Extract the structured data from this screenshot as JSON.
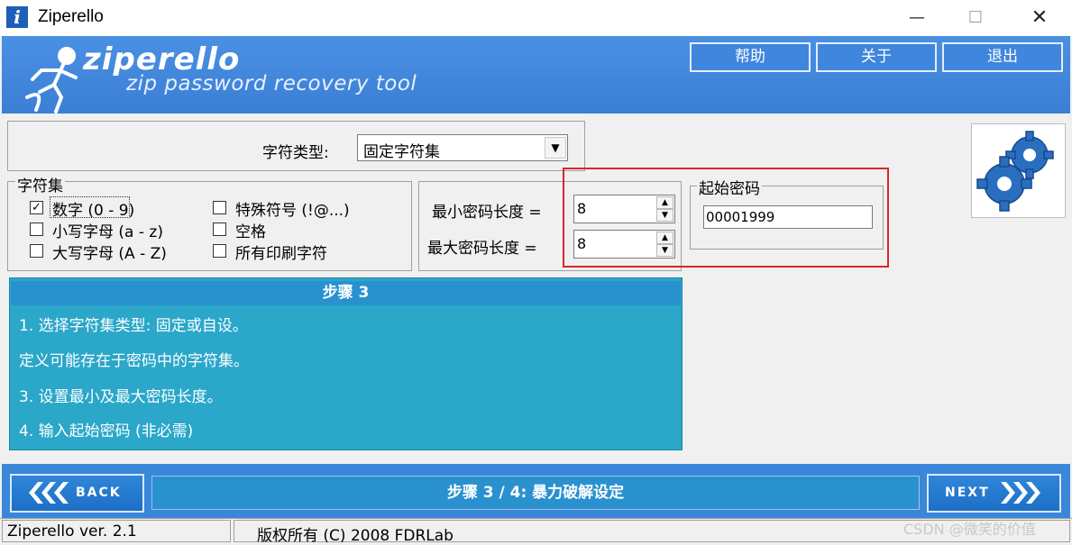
{
  "window": {
    "title": "Ziperello",
    "min_glyph": "—",
    "max_glyph": "☐",
    "close_glyph": "✕"
  },
  "banner": {
    "logo": "ziperello",
    "tagline": "zip password recovery tool",
    "buttons": {
      "help": "帮助",
      "about": "关于",
      "exit": "退出"
    }
  },
  "charset_type": {
    "label": "字符类型:",
    "value": "固定字符集"
  },
  "charset": {
    "legend": "字符集",
    "options": [
      {
        "label": "数字 (0 - 9)",
        "checked": true
      },
      {
        "label": "小写字母 (a - z)",
        "checked": false
      },
      {
        "label": "大写字母 (A - Z)",
        "checked": false
      },
      {
        "label": "特殊符号 (!@...)",
        "checked": false
      },
      {
        "label": "空格",
        "checked": false
      },
      {
        "label": "所有印刷字符",
        "checked": false
      }
    ]
  },
  "length": {
    "min_label": "最小密码长度 =",
    "max_label": "最大密码长度 =",
    "min_value": "8",
    "max_value": "8"
  },
  "start_password": {
    "legend": "起始密码",
    "value": "00001999"
  },
  "steps": {
    "header": "步骤 3",
    "lines": [
      "1. 选择字符集类型: 固定或自设。",
      "定义可能存在于密码中的字符集。",
      "3. 设置最小及最大密码长度。",
      "4. 输入起始密码 (非必需)"
    ]
  },
  "nav": {
    "back": "BACK",
    "next": "NEXT",
    "step_banner": "步骤 3 / 4: 暴力破解设定"
  },
  "status": {
    "version": "Ziperello ver. 2.1",
    "copyright": "版权所有 (C) 2008 FDRLab"
  },
  "watermark": "CSDN @微笑的价值",
  "colors": {
    "banner_blue": "#4a90e2",
    "steps_teal": "#2aa7c9",
    "highlight_red": "#d9252c"
  }
}
